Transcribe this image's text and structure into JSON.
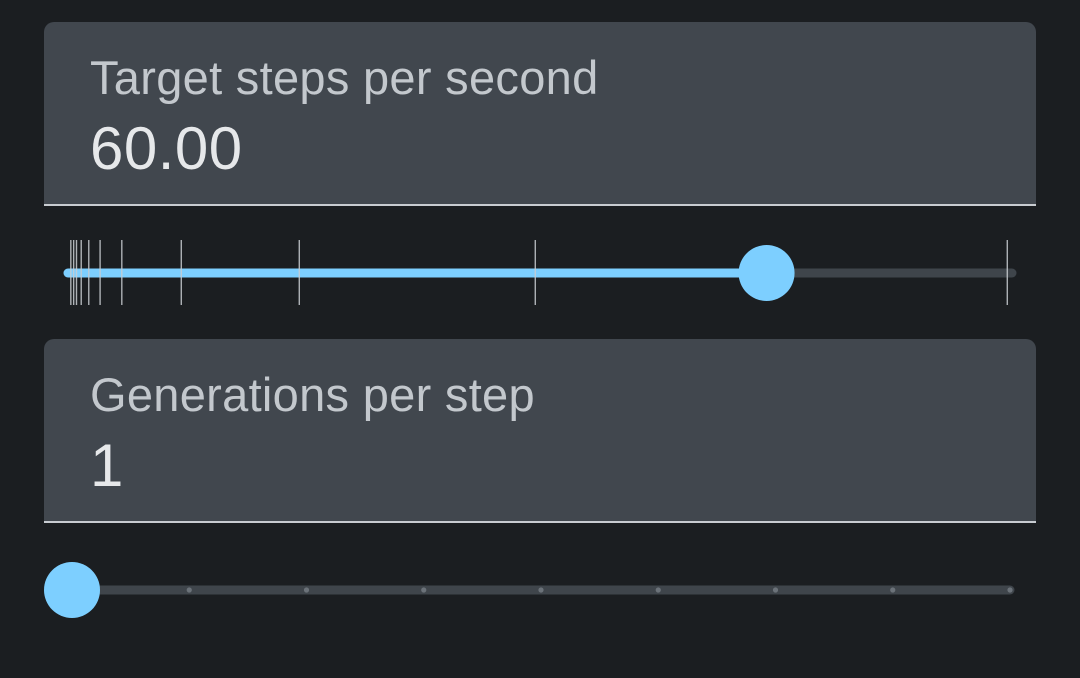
{
  "steps_field": {
    "label": "Target steps per second",
    "value": "60.00"
  },
  "steps_slider": {
    "fraction": 0.74,
    "tick_fractions": [
      0.003,
      0.006,
      0.009,
      0.014,
      0.022,
      0.034,
      0.057,
      0.12,
      0.245,
      0.495,
      0.995
    ]
  },
  "generations_field": {
    "label": "Generations per step",
    "value": "1"
  },
  "generations_slider": {
    "fraction": 0.0,
    "dot_count": 8
  },
  "colors": {
    "accent": "#7dcfff",
    "track": "#3f454b",
    "field_bg": "#41474e",
    "background": "#1b1e21"
  }
}
